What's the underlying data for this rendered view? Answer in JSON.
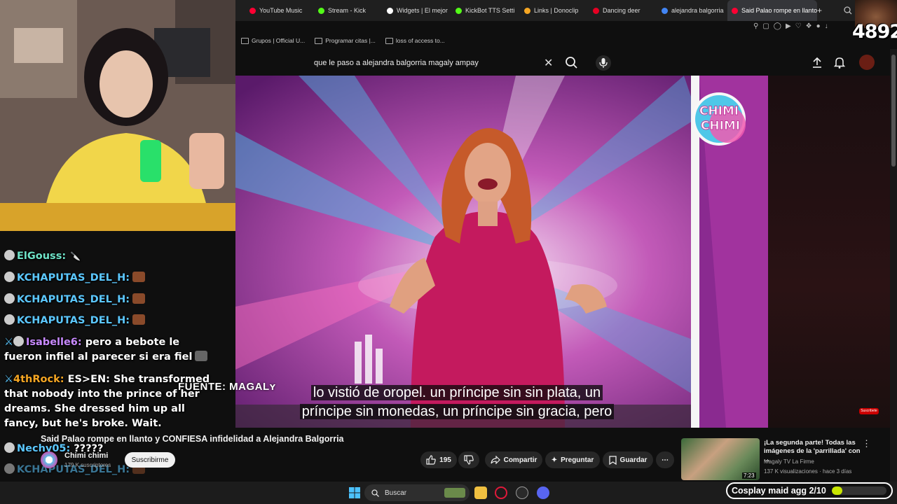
{
  "browser": {
    "tabs": [
      {
        "label": "YouTube Music",
        "color": "#ff0033"
      },
      {
        "label": "Stream - Kick",
        "color": "#53fc18"
      },
      {
        "label": "Widgets | El mejor",
        "color": "#ffffff"
      },
      {
        "label": "KickBot TTS Setti",
        "color": "#53fc18"
      },
      {
        "label": "Links | Donoclip",
        "color": "#f5a623"
      },
      {
        "label": "Dancing deer",
        "color": "#e60023"
      },
      {
        "label": "alejandra balgorria",
        "color": "#4285f4"
      },
      {
        "label": "Said Palao rompe en llanto",
        "color": "#ff0033",
        "active": true
      }
    ],
    "new_tab": "+",
    "bookmarks": [
      {
        "label": "Grupos | Official U..."
      },
      {
        "label": "Programar citas |..."
      },
      {
        "label": "loss of access to..."
      }
    ]
  },
  "youtube": {
    "search_query": "que le paso a alejandra balgorria magaly ampay",
    "clear_icon": "close-icon",
    "search_icon": "search-icon",
    "mic_icon": "microphone-icon",
    "video": {
      "subtitle_line1": "lo vistió de oropel. un príncipe sin sin plata, un",
      "subtitle_line2": "príncipe sin monedas, un príncipe sin gracia, pero",
      "source_overlay": "FUENTE: MAGALʏ",
      "logo_line1": "CHIMI",
      "logo_line2": "CHIMI",
      "corner_tag": "Suscribete"
    },
    "title": "Said Palao rompe en llanto y CONFIESA infidelidad a Alejandra Balgorria",
    "channel": {
      "name": "Chimi chimi",
      "subscribers": "179 K suscriptores",
      "subscribe_label": "Suscribirme"
    },
    "actions": {
      "likes": "195",
      "share": "Compartir",
      "ask": "Preguntar",
      "save": "Guardar",
      "more": "⋯"
    },
    "recommended": {
      "title": "¡La segunda parte! Todas las imágenes de la 'parrillada' con ...",
      "channel": "Magaly TV La Firme",
      "meta": "137 K visualizaciones · hace 3 días",
      "duration": "7:23"
    }
  },
  "chat": {
    "messages": [
      {
        "user": "ElGouss:",
        "color": "#6fe3c8",
        "text": ""
      },
      {
        "user": "KCHAPUTAS_DEL_H:",
        "color": "#5cc8ff",
        "text": ""
      },
      {
        "user": "KCHAPUTAS_DEL_H:",
        "color": "#5cc8ff",
        "text": ""
      },
      {
        "user": "KCHAPUTAS_DEL_H:",
        "color": "#5cc8ff",
        "text": ""
      },
      {
        "user": "Isabelle6:",
        "color": "#c88aff",
        "text": "pero a bebote le fueron infiel al parecer si era fiel"
      },
      {
        "user": "4thRock:",
        "color": "#f5a623",
        "text": "ES>EN: She transformed that nobody into the prince of her dreams. She dressed him up all fancy, but he's broke. Wait."
      },
      {
        "user": "Nechy05:",
        "color": "#5cc8ff",
        "text": "?????"
      },
      {
        "user": "KCHAPUTAS_DEL_H:",
        "color": "#5cc8ff",
        "text": ""
      }
    ]
  },
  "taskbar": {
    "search_label": "Buscar"
  },
  "overlay": {
    "viewer_count": "4892",
    "cosplay_label": "Cosplay maid agg 2/10",
    "cosplay_progress": 0.2
  }
}
